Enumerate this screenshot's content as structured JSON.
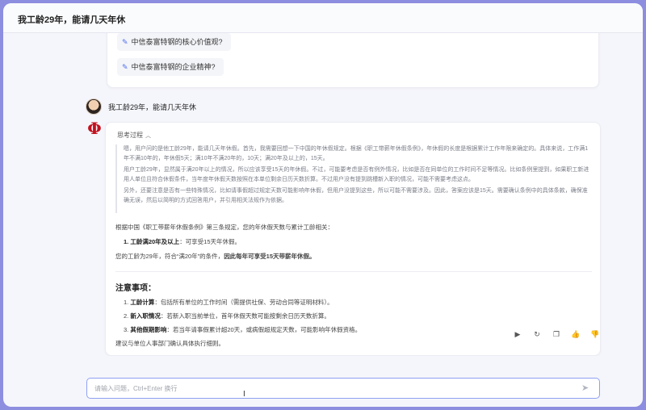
{
  "header": {
    "title": "我工龄29年，能请几天年休"
  },
  "suggestions": [
    {
      "label": "中信泰富特钢的核心价值观?"
    },
    {
      "label": "中信泰富特钢的企业精神?"
    }
  ],
  "user_message": {
    "text": "我工龄29年，能请几天年休"
  },
  "answer": {
    "think_label": "思考过程",
    "think_paragraphs": [
      "嗯，用户问的是他工龄29年，能请几天年休假。首先，我需要回想一下中国的年休假规定。根据《职工带薪年休假条例》，年休假的长度是根据累计工作年限来确定的。具体来说，工作满1年不满10年的，年休假5天；满10年不满20年的，10天；满20年及以上的，15天。",
      "用户工龄29年，显然属于满20年以上的情况，所以应该享受15天的年休假。不过，可能要考虑是否有例外情况，比如是否在同单位的工作时间不足等情况。比如条例里提到，如果职工新进用人单位且符合休假条件，当年度年休假天数按照在本单位剩余日历天数折算。不过用户没有提到跳槽新入职的情况，可能不需要考虑这点。",
      "另外，还要注意是否有一些特殊情况，比如请事假超过规定天数可能影响年休假，但用户没提到这些，所以可能不需要涉及。因此，答案应该是15天。需要确认条例中的具体条款，确保准确无误，然后以简明的方式回答用户，并引用相关法规作为依据。"
    ],
    "intro": "根据中国《职工带薪年休假条例》第三条规定，您的年休假天数与累计工龄相关：",
    "rule_item": {
      "bold": "1. 工龄满20年及以上",
      "rest": "：可享受15天年休假。"
    },
    "conclusion_prefix": "您的工龄为29年，符合“满20年”的条件，",
    "conclusion_bold": "因此每年可享受15天带薪年休假。",
    "notes_title": "注意事项：",
    "notes": [
      {
        "bold": "工龄计算",
        "rest": "：包括所有单位的工作时间（需提供社保、劳动合同等证明材料）。"
      },
      {
        "bold": "新入职情况",
        "rest": "：若新入职当前单位，首年休假天数可能按剩余日历天数折算。"
      },
      {
        "bold": "其他假期影响",
        "rest": "：若当年请事假累计超20天，或病假超规定天数，可能影响年休假资格。"
      }
    ],
    "advice": "建议与单位人事部门确认具体执行细则。"
  },
  "toolbar": {
    "icons": [
      "play-icon",
      "refresh-icon",
      "copy-icon",
      "thumbs-up-icon",
      "thumbs-down-icon"
    ]
  },
  "input": {
    "placeholder": "请输入问题，Ctrl+Enter 换行"
  },
  "colors": {
    "accent": "#8fa0f3",
    "frame": "#8d8ee0",
    "logo": "#c1121f"
  }
}
